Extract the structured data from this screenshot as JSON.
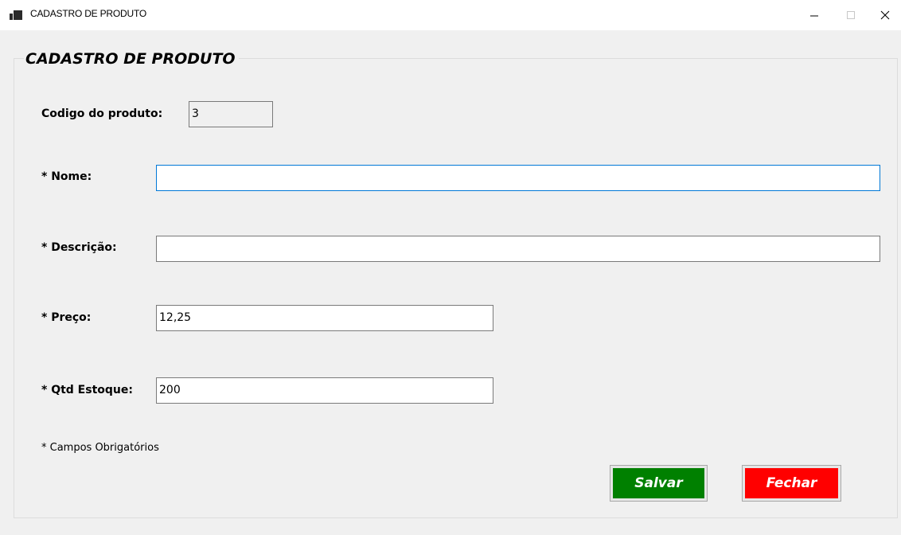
{
  "window": {
    "title": "CADASTRO DE PRODUTO",
    "icon": "app-window-icon",
    "controls": [
      "minimize-icon",
      "maximize-icon",
      "close-icon"
    ]
  },
  "form": {
    "group_title": "CADASTRO DE PRODUTO",
    "fields": {
      "codigo": {
        "label": "Codigo do produto:",
        "value": "3"
      },
      "nome": {
        "label": "* Nome:",
        "value": ""
      },
      "descricao": {
        "label": "* Descrição:",
        "value": ""
      },
      "preco": {
        "label": "* Preço:",
        "value": "12,25"
      },
      "qtd_estoque": {
        "label": "* Qtd Estoque:",
        "value": "200"
      }
    },
    "required_note": "* Campos Obrigatórios",
    "buttons": {
      "save_label": "Salvar",
      "close_label": "Fechar"
    }
  },
  "colors": {
    "save_button": "#008000",
    "close_button": "#ff0000",
    "focus_border": "#0078d7"
  }
}
